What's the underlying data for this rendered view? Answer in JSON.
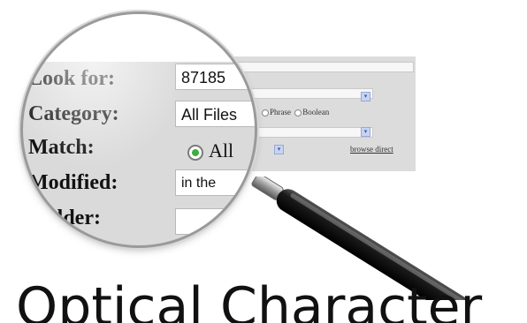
{
  "background_form": {
    "radio_phrase": "Phrase",
    "radio_boolean": "Boolean",
    "browse_link": "browse direct"
  },
  "lens": {
    "labels": {
      "look_for": "Look for:",
      "category": "Category:",
      "match": "Match:",
      "modified": "Modified:",
      "folder": "Folder:"
    },
    "values": {
      "look_for": "87185",
      "category": "All Files",
      "match_option": "All",
      "modified": "in the",
      "folder": ""
    }
  },
  "caption": {
    "title": "Optical Character"
  },
  "colors": {
    "radio_selected": "#3cae3c",
    "form_background": "#dcdcdc",
    "handle": "#111111"
  },
  "icons": {
    "magnifier": "magnifying-glass-icon",
    "dropdown_arrow": "chevron-down-icon"
  }
}
